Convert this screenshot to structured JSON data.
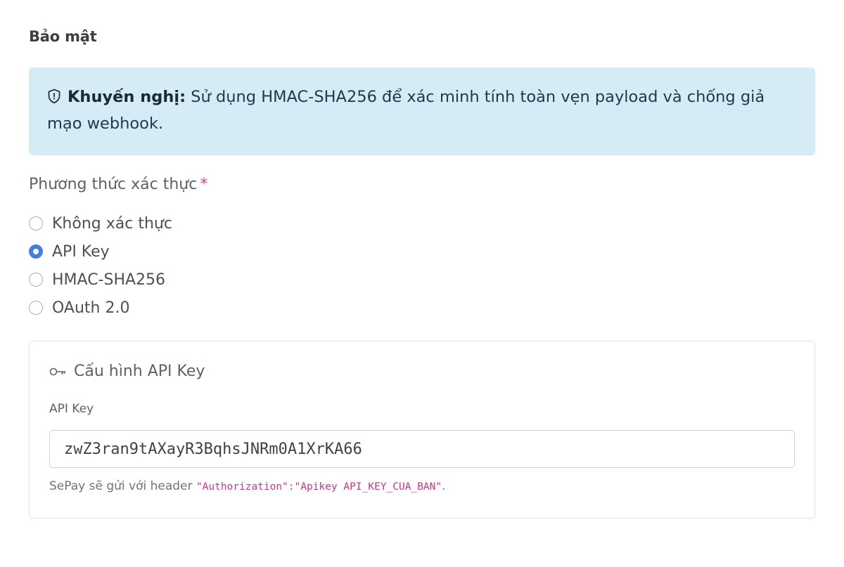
{
  "section": {
    "title": "Bảo mật"
  },
  "alert": {
    "icon": "shield-icon",
    "label": "Khuyến nghị:",
    "text": " Sử dụng HMAC-SHA256 để xác minh tính toàn vẹn payload và chống giả mạo webhook."
  },
  "auth": {
    "label": "Phương thức xác thực",
    "required_mark": "*",
    "selected": "API Key",
    "options": [
      {
        "label": "Không xác thực",
        "checked": false
      },
      {
        "label": "API Key",
        "checked": true
      },
      {
        "label": "HMAC-SHA256",
        "checked": false
      },
      {
        "label": "OAuth 2.0",
        "checked": false
      }
    ]
  },
  "api_key_config": {
    "icon": "key-icon",
    "title": "Cấu hình API Key",
    "field_label": "API Key",
    "value": "zwZ3ran9tAXayR3BqhsJNRm0A1XrKA66",
    "help_prefix": "SePay sẽ gửi với header ",
    "help_code": "\"Authorization\":\"Apikey API_KEY_CUA_BAN\"",
    "help_suffix": "."
  },
  "colors": {
    "accent": "#3d7fe6",
    "alert_bg": "#d5ebf5",
    "required": "#e83e8c",
    "code": "#d63384"
  }
}
